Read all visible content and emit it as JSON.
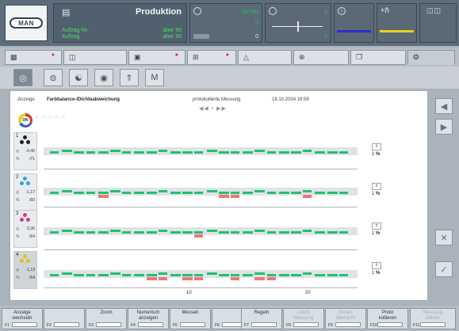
{
  "header": {
    "logo_text": "MAN",
    "title": "Produktion",
    "job_label": "Auftrag-Nr.",
    "job_value": "aber 99",
    "order_label": "Auftrag",
    "order_value": "aber 99",
    "speed_value": "10.000",
    "speed_value2": "0",
    "speed_value3": "0",
    "pos_value": "0",
    "pos_value2": "0",
    "accent_green": "#1ec93a",
    "status_blue": "#2a2fc8",
    "status_yellow": "#e6d21c"
  },
  "tabs": [
    {
      "icon": "monitor-icon"
    },
    {
      "icon": "machine-icon"
    },
    {
      "icon": "page-icon"
    },
    {
      "icon": "route-icon"
    },
    {
      "icon": "chart-icon"
    },
    {
      "icon": "register-icon"
    },
    {
      "icon": "copy-icon"
    },
    {
      "icon": "color-wheel-icon"
    }
  ],
  "tools": [
    {
      "name": "gauge-tool"
    },
    {
      "name": "roller-tool"
    },
    {
      "name": "balance-tool"
    },
    {
      "name": "color-tool"
    },
    {
      "name": "arrow-tool"
    },
    {
      "name": "m-tool",
      "label": "M"
    }
  ],
  "main": {
    "anzeige_label": "Anzeige",
    "title": "Farbbalance-/Dichteabweichung",
    "measure_label": "protokollierte Messung",
    "timestamp": "18.10.2004 18:59",
    "ok_label": "OK",
    "rows": [
      {
        "num": "1",
        "val1": "-0,40",
        "val2": "/71",
        "unit": "%"
      },
      {
        "num": "2",
        "val1": "-1,17",
        "val2": "/60",
        "unit": "%"
      },
      {
        "num": "3",
        "val1": "0,36",
        "val2": "/64",
        "unit": "%"
      },
      {
        "num": "4",
        "val1": "-1,13",
        "val2": "/64",
        "unit": "%"
      }
    ],
    "scale_value": "1",
    "scale_unit": "%",
    "x_ticks": [
      "10",
      "20"
    ]
  },
  "fkeys": [
    {
      "label": "Anzeige\nwechseln",
      "fn": "F1"
    },
    {
      "label": "",
      "fn": "F2"
    },
    {
      "label": "Zoom",
      "fn": "F3"
    },
    {
      "label": "Numerisch\nanzeigen",
      "fn": "F4"
    },
    {
      "label": "Messen",
      "fn": "F5"
    },
    {
      "label": "",
      "fn": "F6"
    },
    {
      "label": "Regeln",
      "fn": "F7"
    },
    {
      "label": "Letzte\nMessung",
      "fn": "F8",
      "dim": true
    },
    {
      "label": "Zonen-\nübersicht",
      "fn": "F9",
      "dim": true
    },
    {
      "label": "Proto\nkollieren",
      "fn": "F10"
    },
    {
      "label": "Messung\nwählen",
      "fn": "F11",
      "dim": true
    }
  ]
}
